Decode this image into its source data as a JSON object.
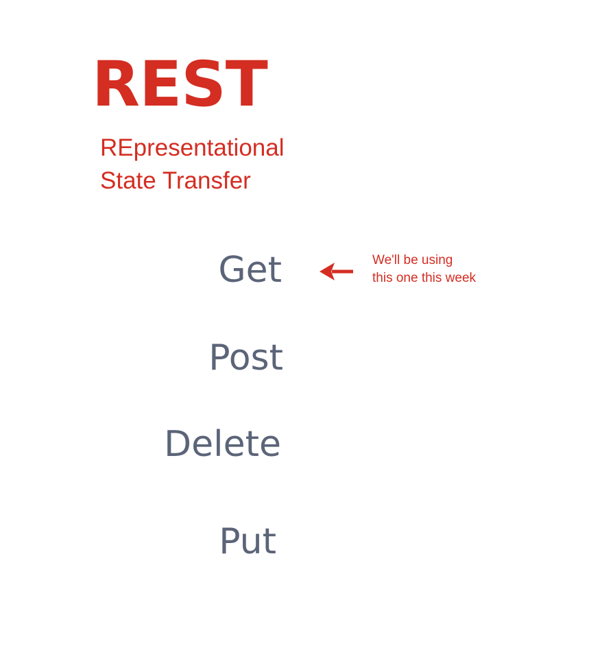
{
  "colors": {
    "accent": "#d42d22",
    "method_text": "#5b6478",
    "background": "#ffffff"
  },
  "title": "REST",
  "subtitle": {
    "line1": "REpresentational",
    "line2": "State Transfer"
  },
  "methods": [
    {
      "label": "Get"
    },
    {
      "label": "Post"
    },
    {
      "label": "Delete"
    },
    {
      "label": "Put"
    }
  ],
  "annotation": {
    "icon": "arrow-left-icon",
    "line1": "We'll be using",
    "line2": "this one this week"
  }
}
